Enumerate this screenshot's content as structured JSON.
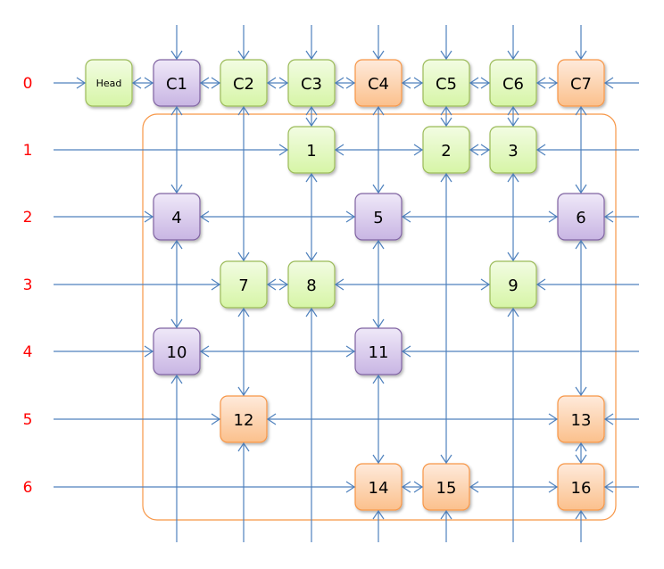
{
  "row_labels": [
    "0",
    "1",
    "2",
    "3",
    "4",
    "5",
    "6"
  ],
  "colors": {
    "line": "#4f81bd",
    "row_label": "#ff0000",
    "group_outline": "#f79646",
    "green": {
      "top": "#f2fce2",
      "bottom": "#d6f5a6",
      "stroke": "#9bbb59"
    },
    "purple": {
      "top": "#efe8f8",
      "bottom": "#c8b5e3",
      "stroke": "#8064a2"
    },
    "orange": {
      "top": "#feeadb",
      "bottom": "#fbc08c",
      "stroke": "#f79646"
    }
  },
  "nodes": [
    {
      "label": "Head",
      "col": 0,
      "row": 0,
      "color": "green",
      "small": true
    },
    {
      "label": "C1",
      "col": 1,
      "row": 0,
      "color": "purple"
    },
    {
      "label": "C2",
      "col": 2,
      "row": 0,
      "color": "green"
    },
    {
      "label": "C3",
      "col": 3,
      "row": 0,
      "color": "green"
    },
    {
      "label": "C4",
      "col": 4,
      "row": 0,
      "color": "orange"
    },
    {
      "label": "C5",
      "col": 5,
      "row": 0,
      "color": "green"
    },
    {
      "label": "C6",
      "col": 6,
      "row": 0,
      "color": "green"
    },
    {
      "label": "C7",
      "col": 7,
      "row": 0,
      "color": "orange"
    },
    {
      "label": "1",
      "col": 3,
      "row": 1,
      "color": "green"
    },
    {
      "label": "2",
      "col": 5,
      "row": 1,
      "color": "green"
    },
    {
      "label": "3",
      "col": 6,
      "row": 1,
      "color": "green"
    },
    {
      "label": "4",
      "col": 1,
      "row": 2,
      "color": "purple"
    },
    {
      "label": "5",
      "col": 4,
      "row": 2,
      "color": "purple"
    },
    {
      "label": "6",
      "col": 7,
      "row": 2,
      "color": "purple"
    },
    {
      "label": "7",
      "col": 2,
      "row": 3,
      "color": "green"
    },
    {
      "label": "8",
      "col": 3,
      "row": 3,
      "color": "green"
    },
    {
      "label": "9",
      "col": 6,
      "row": 3,
      "color": "green"
    },
    {
      "label": "10",
      "col": 1,
      "row": 4,
      "color": "purple"
    },
    {
      "label": "11",
      "col": 4,
      "row": 4,
      "color": "purple"
    },
    {
      "label": "12",
      "col": 2,
      "row": 5,
      "color": "orange"
    },
    {
      "label": "13",
      "col": 7,
      "row": 5,
      "color": "orange"
    },
    {
      "label": "14",
      "col": 4,
      "row": 6,
      "color": "orange"
    },
    {
      "label": "15",
      "col": 5,
      "row": 6,
      "color": "orange"
    },
    {
      "label": "16",
      "col": 7,
      "row": 6,
      "color": "orange"
    }
  ]
}
